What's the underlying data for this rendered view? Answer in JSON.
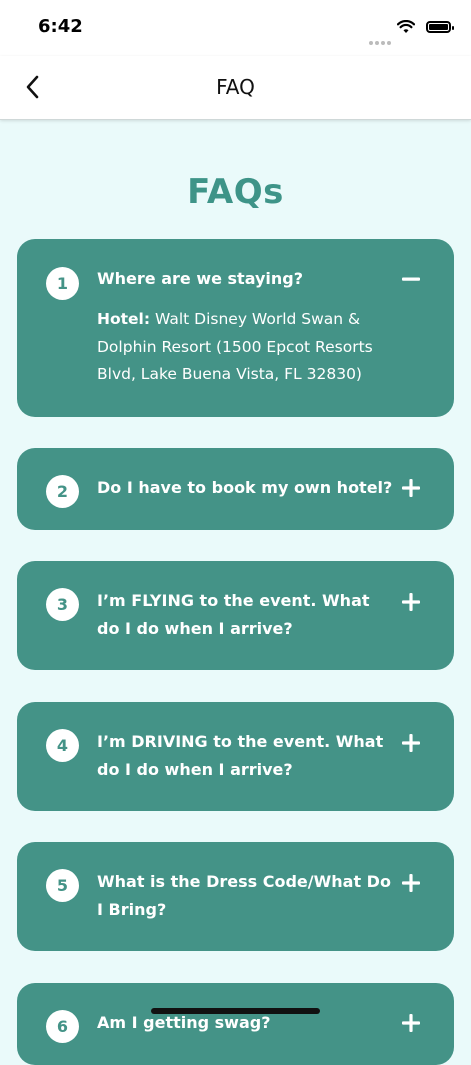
{
  "status_bar": {
    "time": "6:42"
  },
  "nav": {
    "title": "FAQ",
    "back_icon": "chevron-left-icon"
  },
  "page_heading": "FAQs",
  "colors": {
    "accent": "#449387",
    "heading": "#3e9488",
    "background": "#eafafa"
  },
  "faqs": [
    {
      "number": "1",
      "question": "Where are we staying?",
      "expanded": true,
      "answer_label": "Hotel:",
      "answer_text": "Walt Disney World Swan & Dolphin Resort (1500 Epcot Resorts Blvd, Lake Buena Vista, FL 32830)"
    },
    {
      "number": "2",
      "question": "Do I have to book my own hotel?",
      "expanded": false
    },
    {
      "number": "3",
      "question": "I’m FLYING to the event. What do I do when I arrive?",
      "expanded": false
    },
    {
      "number": "4",
      "question": "I’m DRIVING to the event. What do I do when I arrive?",
      "expanded": false
    },
    {
      "number": "5",
      "question": "What is the Dress Code/What Do I Bring?",
      "expanded": false
    },
    {
      "number": "6",
      "question": "Am I getting swag?",
      "expanded": false
    }
  ]
}
